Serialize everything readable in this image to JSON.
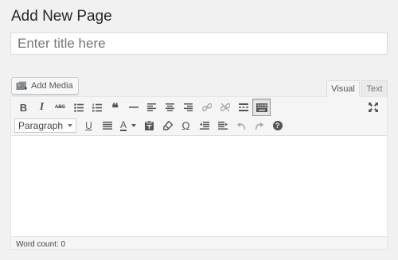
{
  "page": {
    "title": "Add New Page"
  },
  "title_field": {
    "placeholder": "Enter title here",
    "value": ""
  },
  "media": {
    "add_media_label": "Add Media"
  },
  "editor_tabs": [
    {
      "label": "Visual",
      "active": true
    },
    {
      "label": "Text",
      "active": false
    }
  ],
  "toolbar": {
    "row1": [
      "bold-icon",
      "italic-icon",
      "strikethrough-icon",
      "bulleted-list-icon",
      "numbered-list-icon",
      "blockquote-icon",
      "horizontal-line-icon",
      "align-left-icon",
      "align-center-icon",
      "align-right-icon",
      "insert-link-icon",
      "remove-link-icon",
      "read-more-icon",
      "toolbar-toggle-icon",
      "fullscreen-icon"
    ],
    "row2": [
      "paragraph-format-select",
      "underline-icon",
      "justify-icon",
      "text-color-icon",
      "paste-as-text-icon",
      "clear-formatting-icon",
      "special-character-icon",
      "outdent-icon",
      "indent-icon",
      "undo-icon",
      "redo-icon",
      "keyboard-shortcuts-icon"
    ],
    "bold_label": "B",
    "italic_label": "I",
    "strike_label": "ABC",
    "quote_label": "❝",
    "underline_label": "U",
    "text_color_label": "A",
    "special_char_label": "Ω",
    "help_label": "?",
    "format_select": {
      "selected": "Paragraph"
    }
  },
  "status": {
    "word_count": "Word count: 0"
  },
  "colors": {
    "background": "#f1f1f1",
    "toolbar": "#f5f5f5",
    "editor_bg": "#ffffff",
    "border": "#dddddd",
    "icon": "#555555"
  }
}
